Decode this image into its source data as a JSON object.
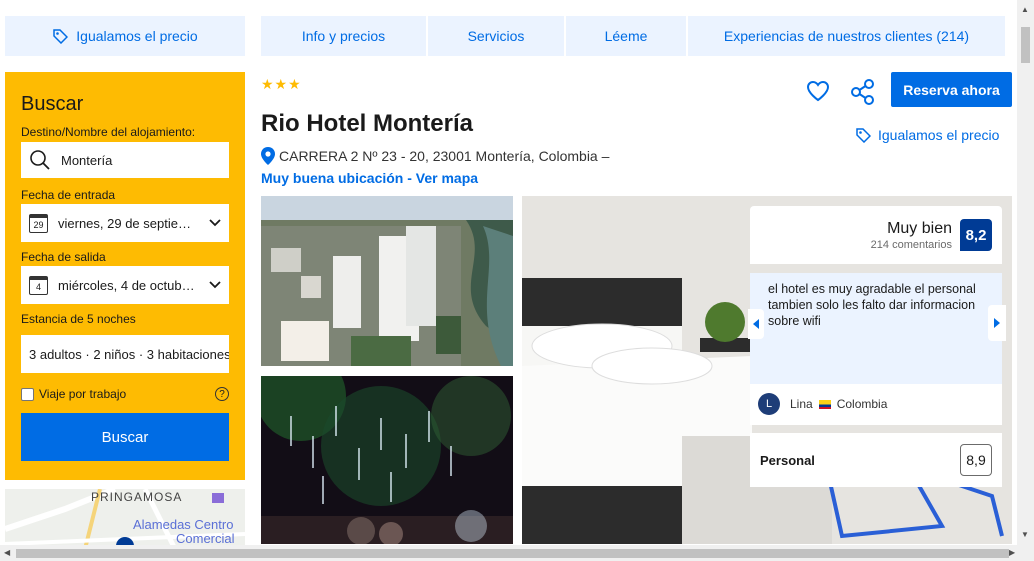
{
  "nav": {
    "price_match": "Igualamos el precio",
    "tabs": [
      {
        "label": "Info y precios"
      },
      {
        "label": "Servicios"
      },
      {
        "label": "Léeme"
      },
      {
        "label": "Experiencias de nuestros clientes (214)"
      }
    ]
  },
  "search": {
    "title": "Buscar",
    "destination_label": "Destino/Nombre del alojamiento:",
    "destination_value": "Montería",
    "checkin_label": "Fecha de entrada",
    "checkin_day": "29",
    "checkin_value": "viernes, 29 de septie…",
    "checkout_label": "Fecha de salida",
    "checkout_day": "4",
    "checkout_value": "miércoles, 4 de octub…",
    "stay_label": "Estancia de 5 noches",
    "guests_value": "3 adultos · 2 niños · 3 habitaciones",
    "work_trip_label": "Viaje por trabajo",
    "help_icon": "?",
    "button_label": "Buscar"
  },
  "map": {
    "label_1": "PRINGAMOSA",
    "label_2": "Alamedas Centro",
    "label_3": "Comercial"
  },
  "hotel": {
    "stars": "★★★",
    "name": "Rio Hotel Montería",
    "address": "CARRERA 2 Nº 23 - 20, 23001 Montería, Colombia –",
    "location_link": "Muy buena ubicación - Ver mapa",
    "reserve_label": "Reserva ahora",
    "price_match": "Igualamos el precio"
  },
  "review": {
    "score_label": "Muy bien",
    "score_count": "214 comentarios",
    "score": "8,2",
    "text": "el hotel es muy agradable el personal tambien solo les falto dar informacion sobre wifi",
    "reviewer_initial": "L",
    "reviewer_name": "Lina",
    "reviewer_country": "Colombia",
    "staff_label": "Personal",
    "staff_score": "8,9"
  },
  "colors": {
    "brand_blue": "#006ce4",
    "search_yellow": "#febb02",
    "dark_blue": "#003b95",
    "tab_bg": "#ebf3ff"
  }
}
